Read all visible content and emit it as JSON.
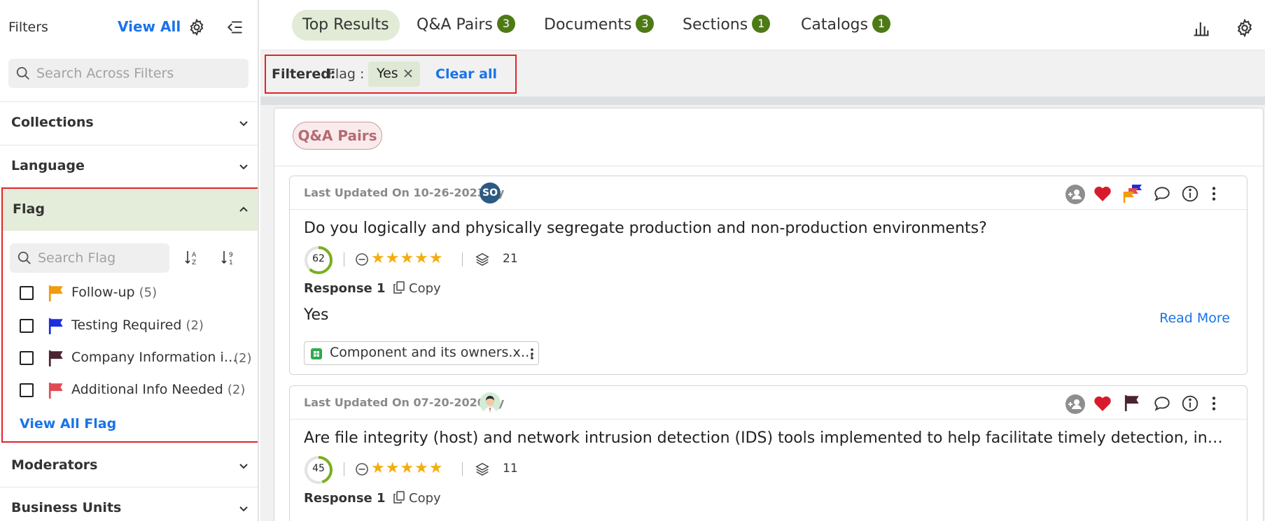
{
  "sidebar": {
    "title": "Filters",
    "view_all": "View All",
    "search_placeholder": "Search Across Filters",
    "sections": {
      "collections": "Collections",
      "language": "Language",
      "flag": "Flag",
      "moderators": "Moderators",
      "business_units": "Business Units"
    },
    "flag_search_placeholder": "Search Flag",
    "flag_items": [
      {
        "label": "Follow-up",
        "count": "(5)",
        "color": "#f29b0c"
      },
      {
        "label": "Testing Required",
        "count": "(2)",
        "color": "#1b2de0"
      },
      {
        "label": "Company Information i…",
        "count": "(2)",
        "color": "#4a2430"
      },
      {
        "label": "Additional Info Needed",
        "count": "(2)",
        "color": "#e04a55"
      }
    ],
    "view_all_flag": "View All Flag"
  },
  "tabs": [
    {
      "label": "Top Results",
      "badge": null,
      "active": true
    },
    {
      "label": "Q&A Pairs",
      "badge": "3"
    },
    {
      "label": "Documents",
      "badge": "3"
    },
    {
      "label": "Sections",
      "badge": "1"
    },
    {
      "label": "Catalogs",
      "badge": "1"
    }
  ],
  "filter_bar": {
    "label": "Filtered:",
    "key": "Flag :",
    "chip_value": "Yes",
    "clear_all": "Clear all"
  },
  "panel": {
    "section_chip": "Q&A Pairs",
    "cards": [
      {
        "updated": "Last Updated On 10-26-2023 by",
        "avatar_initials": "SO",
        "question": "Do you logically and physically segregate production and non-production environments?",
        "score": "62",
        "rating": "★★★★★",
        "layers_count": "21",
        "response_label": "Response 1",
        "copy_label": "Copy",
        "answer": "Yes",
        "read_more": "Read More",
        "attachment": "Component and its owners.x…",
        "flag_color": "#f29b0c"
      },
      {
        "updated": "Last Updated On 07-20-2020 by",
        "question": "Are file integrity (host) and network intrusion detection (IDS) tools implemented to help facilitate timely detection, investigati…",
        "score": "45",
        "rating": "★★★★★",
        "layers_count": "11",
        "response_label": "Response 1",
        "copy_label": "Copy",
        "flag_color": "#4a2430"
      }
    ]
  },
  "colors": {
    "accent": "#1a73e8",
    "badge": "#4e7a16",
    "highlight_border": "#e0242b",
    "heart": "#d81b2c",
    "star": "#f4ad10"
  }
}
